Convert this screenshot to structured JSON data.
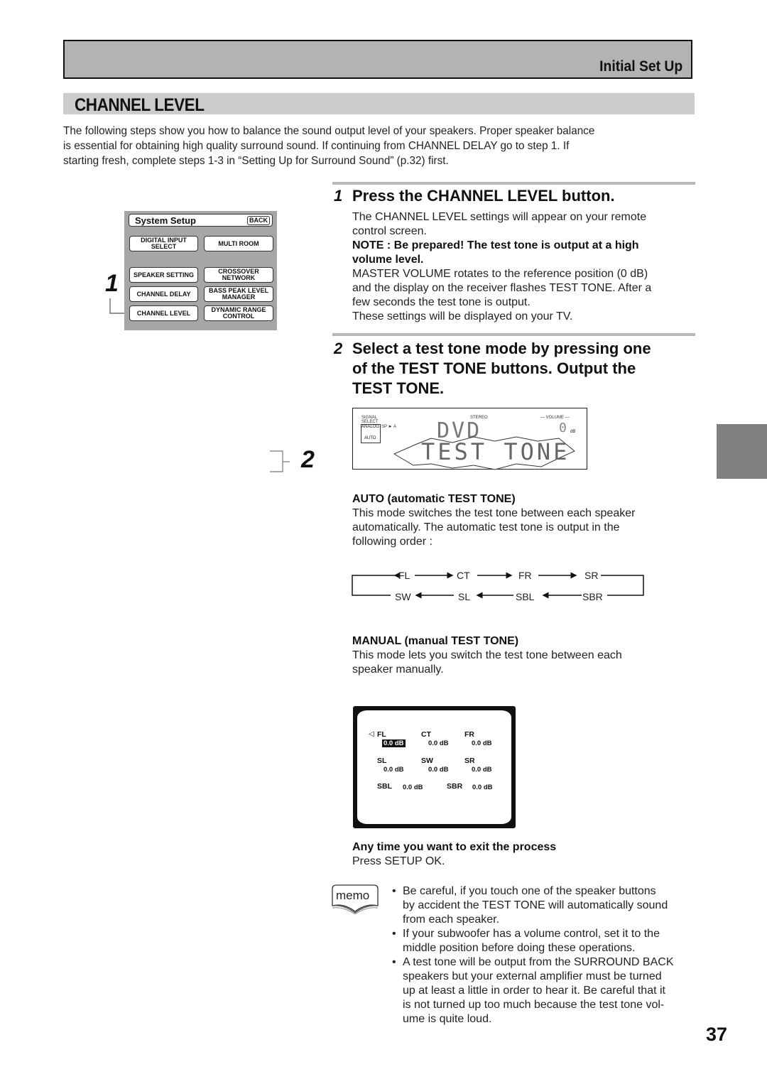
{
  "header": {
    "section": "Initial Set Up"
  },
  "title": "CHANNEL LEVEL",
  "intro_lines": [
    "The following steps show you how to balance the sound output level of your speakers. Proper speaker balance",
    "is essential for obtaining high quality surround sound. If continuing from CHANNEL DELAY go to step 1. If",
    "starting fresh, complete steps 1-3 in “Setting Up for Surround Sound” (p.32) first."
  ],
  "remote": {
    "title": "System Setup",
    "back": "BACK",
    "step_callout": "1",
    "buttons": [
      {
        "label": "DIGITAL INPUT SELECT"
      },
      {
        "label": "MULTI ROOM"
      },
      {
        "label": "SPEAKER SETTING"
      },
      {
        "label": "CROSSOVER NETWORK"
      },
      {
        "label": "CHANNEL DELAY"
      },
      {
        "label": "BASS PEAK LEVEL MANAGER"
      },
      {
        "label": "CHANNEL LEVEL"
      },
      {
        "label": "DYNAMIC RANGE CONTROL"
      }
    ]
  },
  "step1": {
    "num": "1",
    "heading": "Press the CHANNEL LEVEL button.",
    "p1": [
      "The CHANNEL LEVEL settings will appear on your remote",
      "control screen."
    ],
    "note": [
      "NOTE : Be prepared! The test tone is output at a high",
      "volume level."
    ],
    "p2": [
      "MASTER VOLUME rotates to the reference position (0 dB)",
      "and the display on the receiver flashes TEST TONE. After a",
      "few seconds the test tone is output.",
      "These settings will be displayed on your TV."
    ]
  },
  "step2": {
    "num": "2",
    "callout": "2",
    "heading": [
      "Select a test tone mode by pressing one",
      "of the TEST TONE buttons. Output the",
      "TEST TONE."
    ]
  },
  "display": {
    "signal_select": [
      "SIGNAL",
      "SELECT"
    ],
    "analog": "ANALOG",
    "sp": "SP ► A",
    "auto": "AUTO",
    "stereo": "STEREO",
    "volume_label": "VOLUME",
    "volume_value": "0",
    "volume_unit": "dB",
    "source": "DVD",
    "message": "TEST TONE"
  },
  "auto_mode": {
    "heading": "AUTO (automatic TEST TONE)",
    "body": [
      "This mode switches the test tone between each speaker",
      "automatically. The automatic test tone is output in the",
      "following order :"
    ],
    "order_top": [
      "FL",
      "CT",
      "FR",
      "SR"
    ],
    "order_bottom": [
      "SW",
      "SL",
      "SBL",
      "SBR"
    ]
  },
  "manual_mode": {
    "heading": "MANUAL (manual TEST TONE)",
    "body": [
      "This mode lets you switch the test tone between each",
      "speaker manually."
    ]
  },
  "tv_screen": {
    "channels": [
      {
        "name": "FL",
        "value": "0.0 dB",
        "selected": true
      },
      {
        "name": "CT",
        "value": "0.0 dB"
      },
      {
        "name": "FR",
        "value": "0.0 dB"
      },
      {
        "name": "SL",
        "value": "0.0 dB"
      },
      {
        "name": "SW",
        "value": "0.0 dB"
      },
      {
        "name": "SR",
        "value": "0.0 dB"
      },
      {
        "name": "SBL",
        "value": "0.0 dB"
      },
      {
        "name": "SBR",
        "value": "0.0 dB"
      }
    ]
  },
  "exit": {
    "heading": "Any time you want to exit the process",
    "body": "Press SETUP OK."
  },
  "memo": {
    "label": "memo",
    "bullets": [
      [
        "Be careful, if you touch one of the speaker buttons",
        "by accident the TEST TONE will automatically sound",
        "from each speaker."
      ],
      [
        "If your subwoofer has a volume control, set it to the",
        "middle position before doing these operations."
      ],
      [
        "A test tone will be output from the SURROUND BACK",
        "speakers but your external amplifier must be turned",
        "up at least a little in order to hear it. Be careful that it",
        "is not turned up too much because the test tone vol-",
        "ume is quite loud."
      ]
    ]
  },
  "page_number": "37"
}
